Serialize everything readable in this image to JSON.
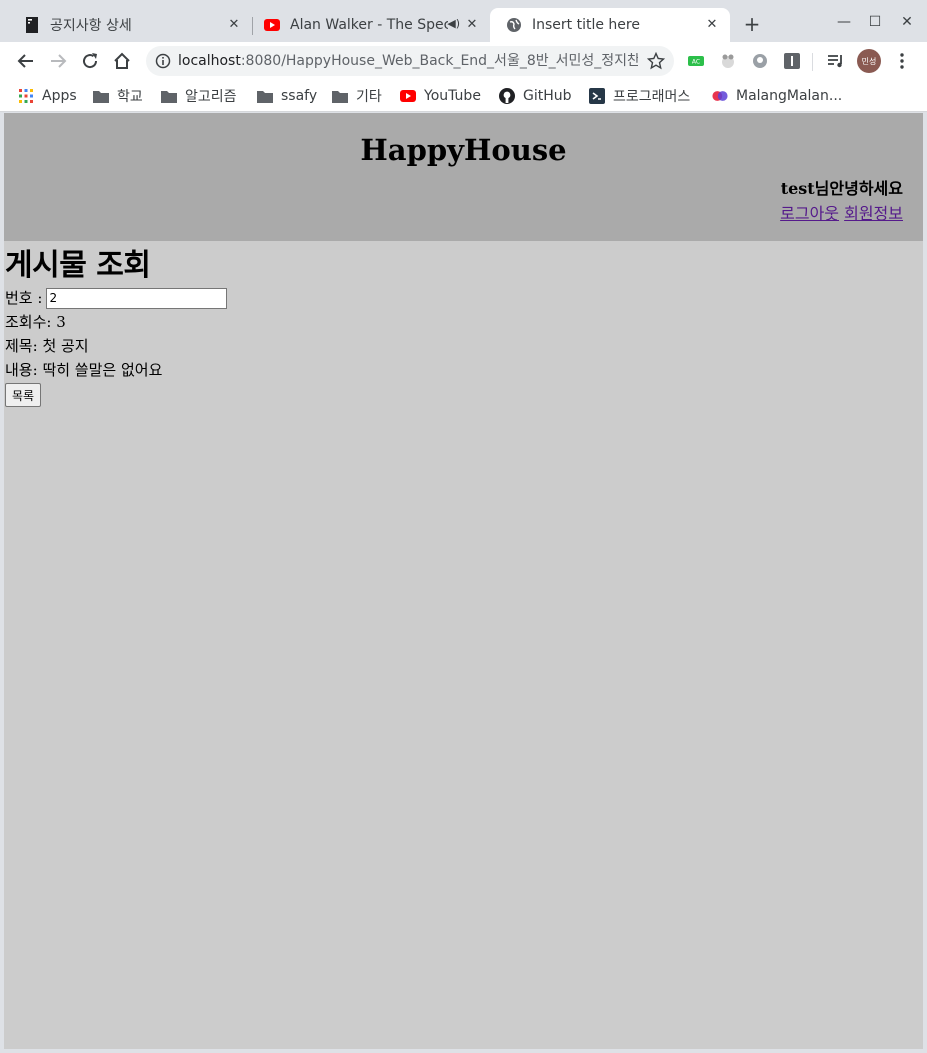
{
  "browser": {
    "tabs": [
      {
        "title": "공지사항 상세",
        "favicon": "document-icon"
      },
      {
        "title": "Alan Walker - The Spec",
        "favicon": "youtube-icon",
        "audio": "speaker-icon"
      },
      {
        "title": "Insert title here",
        "favicon": "globe-icon",
        "active": true
      }
    ],
    "new_tab": "+",
    "address": {
      "host": "localhost",
      "rest": ":8080/HappyHouse_Web_Back_End_서울_8반_서민성_정지찬/..."
    },
    "profile_initials": "민성",
    "bookmarks": [
      "Apps",
      "학교",
      "알고리즘",
      "ssafy",
      "기타",
      "YouTube",
      "GitHub",
      "프로그래머스",
      "MalangMalan..."
    ]
  },
  "site": {
    "title": "HappyHouse",
    "greeting": "test님안녕하세요",
    "logout_link": "로그아웃",
    "member_info_link": "회원정보"
  },
  "article": {
    "heading": "게시물 조회",
    "number_label": "번호 :",
    "number_value": "2",
    "views_label": "조회수:",
    "views_value": "3",
    "title_label": "제목:",
    "title_value": "첫 공지",
    "content_label": "내용:",
    "content_value": "딱히 쓸말은 없어요",
    "list_button": "목록"
  },
  "colors": {
    "header_bg": "#aaaaaa",
    "page_bg": "#cccccc",
    "link_visited": "#551a8b"
  }
}
